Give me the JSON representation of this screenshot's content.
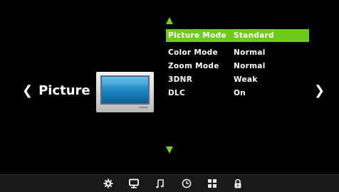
{
  "menu": {
    "section_title": "Picture",
    "rows": [
      {
        "label": "Picture Mode",
        "value": "Standard",
        "selected": true
      },
      {
        "label": "Color Mode",
        "value": "Normal"
      },
      {
        "label": "Zoom Mode",
        "value": "Normal"
      },
      {
        "label": "3DNR",
        "value": "Weak"
      },
      {
        "label": "DLC",
        "value": "On"
      }
    ]
  },
  "nav": {
    "left_glyph": "❮",
    "right_glyph": "❯"
  },
  "bottom_bar": {
    "icons": [
      "settings-gear-icon",
      "monitor-icon",
      "music-note-icon",
      "clock-icon",
      "grid-icon",
      "lock-icon"
    ],
    "active_index": 1
  },
  "colors": {
    "highlight": "#6ecb1b",
    "arrow": "#7ecf1c",
    "background": "#000000",
    "bar": "#191919"
  }
}
